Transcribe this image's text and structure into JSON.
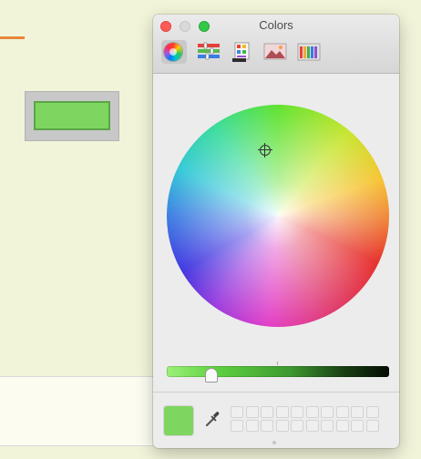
{
  "window": {
    "title": "Colors",
    "traffic_lights": [
      "close",
      "minimize",
      "zoom"
    ]
  },
  "toolbar": {
    "tools": [
      {
        "name": "color-wheel",
        "icon": "color-wheel-icon",
        "selected": true
      },
      {
        "name": "color-sliders",
        "icon": "sliders-icon",
        "selected": false
      },
      {
        "name": "color-palettes",
        "icon": "palette-grid-icon",
        "selected": false
      },
      {
        "name": "image-palettes",
        "icon": "image-icon",
        "selected": false
      },
      {
        "name": "pencils",
        "icon": "crayons-icon",
        "selected": false
      }
    ]
  },
  "colors": {
    "current": "#7ed660",
    "accent_line": "#e8873a",
    "background": "#f2f4d9"
  },
  "brightness": 0.2
}
